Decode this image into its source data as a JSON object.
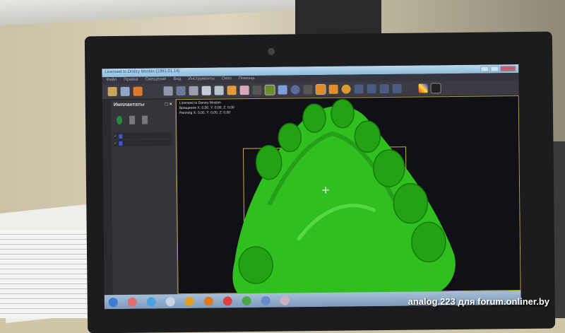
{
  "window": {
    "title": "Licensed to Dmitry Moskin",
    "title_suffix": "(1991.01.14)"
  },
  "menu": [
    "Файл",
    "Правка",
    "Смещение",
    "Вид",
    "Инструменты",
    "Окно",
    "Помощь"
  ],
  "panel": {
    "title": "Имплантаты",
    "close": "□ ×"
  },
  "viewport": {
    "license": "Licensed to Dentry Moskin",
    "rotation": "Вращение X: 0,00, Y: 0,00, Z: 0,00",
    "panning": "Panning X: 0,00, Y: 0,00, Z: 0,00"
  },
  "watermark": "analog.223 для forum.onliner.by",
  "colors": {
    "model": "#2fbf1f",
    "implant": "#2a8ee0",
    "accent": "#b9a24a"
  }
}
